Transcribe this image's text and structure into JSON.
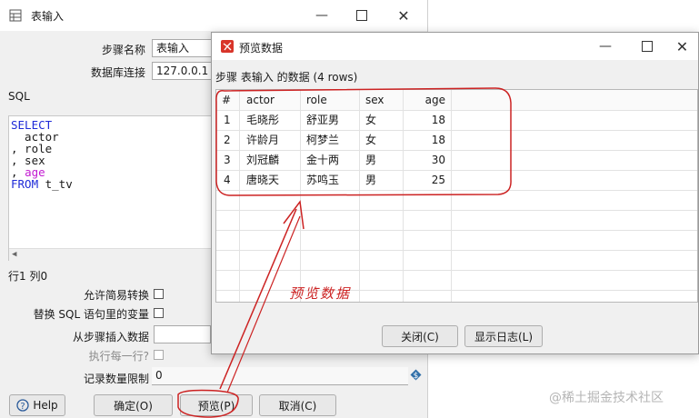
{
  "main_window": {
    "title": "表输入",
    "step_name_label": "步骤名称",
    "step_name_value": "表输入",
    "db_conn_label": "数据库连接",
    "db_conn_value": "127.0.0.1",
    "sql_label": "SQL",
    "sql_lines": {
      "l1": "SELECT",
      "l2": "  actor",
      "l3": ", role",
      "l4": ", sex",
      "l5_prefix": ", ",
      "l5_field": "age",
      "l6_kw": "FROM",
      "l6_rest": " t_tv"
    },
    "cursor_position": "行1 列0",
    "lazy_conversion_label": "允许简易转换",
    "replace_vars_label": "替换 SQL 语句里的变量",
    "insert_from_step_label": "从步骤插入数据",
    "execute_each_row_label": "执行每一行?",
    "row_limit_label": "记录数量限制",
    "row_limit_value": "0",
    "help_button": "Help",
    "ok_button": "确定(O)",
    "preview_button": "预览(P)",
    "cancel_button": "取消(C)"
  },
  "preview_window": {
    "title": "预览数据",
    "header": "步骤 表输入 的数据  (4 rows)",
    "columns": [
      "#",
      "actor",
      "role",
      "sex",
      "age"
    ],
    "rows": [
      [
        "1",
        "毛晓彤",
        "舒亚男",
        "女",
        "18"
      ],
      [
        "2",
        "许龄月",
        "柯梦兰",
        "女",
        "18"
      ],
      [
        "3",
        "刘冠麟",
        "金十两",
        "男",
        "30"
      ],
      [
        "4",
        "唐晓天",
        "苏鸣玉",
        "男",
        "25"
      ]
    ],
    "close_button": "关闭(C)",
    "show_log_button": "显示日志(L)"
  },
  "annotation": {
    "text": "预览数据",
    "color": "#cc2222"
  },
  "watermark": "@稀土掘金技术社区",
  "colors": {
    "sql_keyword": "#1f2bd8",
    "sql_highlight": "#c21ad1",
    "annotation_red": "#cc2222"
  }
}
